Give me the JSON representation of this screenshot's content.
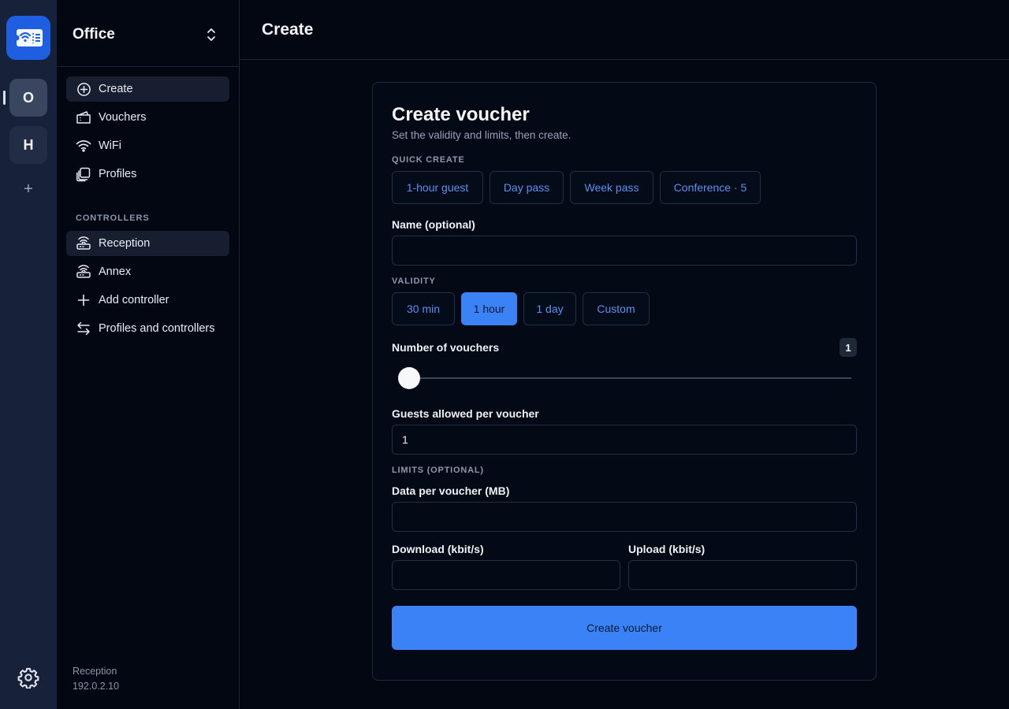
{
  "rail": {
    "workspaces": [
      {
        "letter": "O",
        "active": true
      },
      {
        "letter": "H",
        "active": false
      }
    ],
    "add_label": "+"
  },
  "sidebar": {
    "title": "Office",
    "nav": [
      {
        "label": "Create",
        "icon": "plus-circle-icon",
        "active": true
      },
      {
        "label": "Vouchers",
        "icon": "ticket-icon",
        "active": false
      },
      {
        "label": "WiFi",
        "icon": "wifi-icon",
        "active": false
      },
      {
        "label": "Profiles",
        "icon": "profiles-icon",
        "active": false
      }
    ],
    "controllers_heading": "CONTROLLERS",
    "controllers": [
      {
        "label": "Reception",
        "icon": "router-icon",
        "active": true
      },
      {
        "label": "Annex",
        "icon": "router-icon",
        "active": false
      },
      {
        "label": "Add controller",
        "icon": "plus-icon",
        "active": false
      },
      {
        "label": "Profiles and controllers",
        "icon": "swap-arrows-icon",
        "active": false
      }
    ],
    "footer": {
      "controller": "Reception",
      "ip": "192.0.2.10"
    }
  },
  "header": {
    "title": "Create"
  },
  "form": {
    "title": "Create voucher",
    "subtitle": "Set the validity and limits, then create.",
    "quick_create_heading": "QUICK CREATE",
    "quick_create": [
      "1-hour guest",
      "Day pass",
      "Week pass",
      "Conference · 5"
    ],
    "name_label": "Name (optional)",
    "name_value": "",
    "validity_heading": "VALIDITY",
    "validity_options": [
      "30 min",
      "1 hour",
      "1 day",
      "Custom"
    ],
    "validity_selected": "1 hour",
    "count_label": "Number of vouchers",
    "count_value": "1",
    "guests_label": "Guests allowed per voucher",
    "guests_value": "1",
    "limits_heading": "LIMITS (OPTIONAL)",
    "data_label": "Data per voucher (MB)",
    "data_value": "",
    "download_label": "Download (kbit/s)",
    "download_value": "",
    "upload_label": "Upload (kbit/s)",
    "upload_value": "",
    "submit_label": "Create voucher"
  },
  "colors": {
    "accent": "#3b82f6",
    "background": "#020712",
    "rail": "#17213a"
  }
}
